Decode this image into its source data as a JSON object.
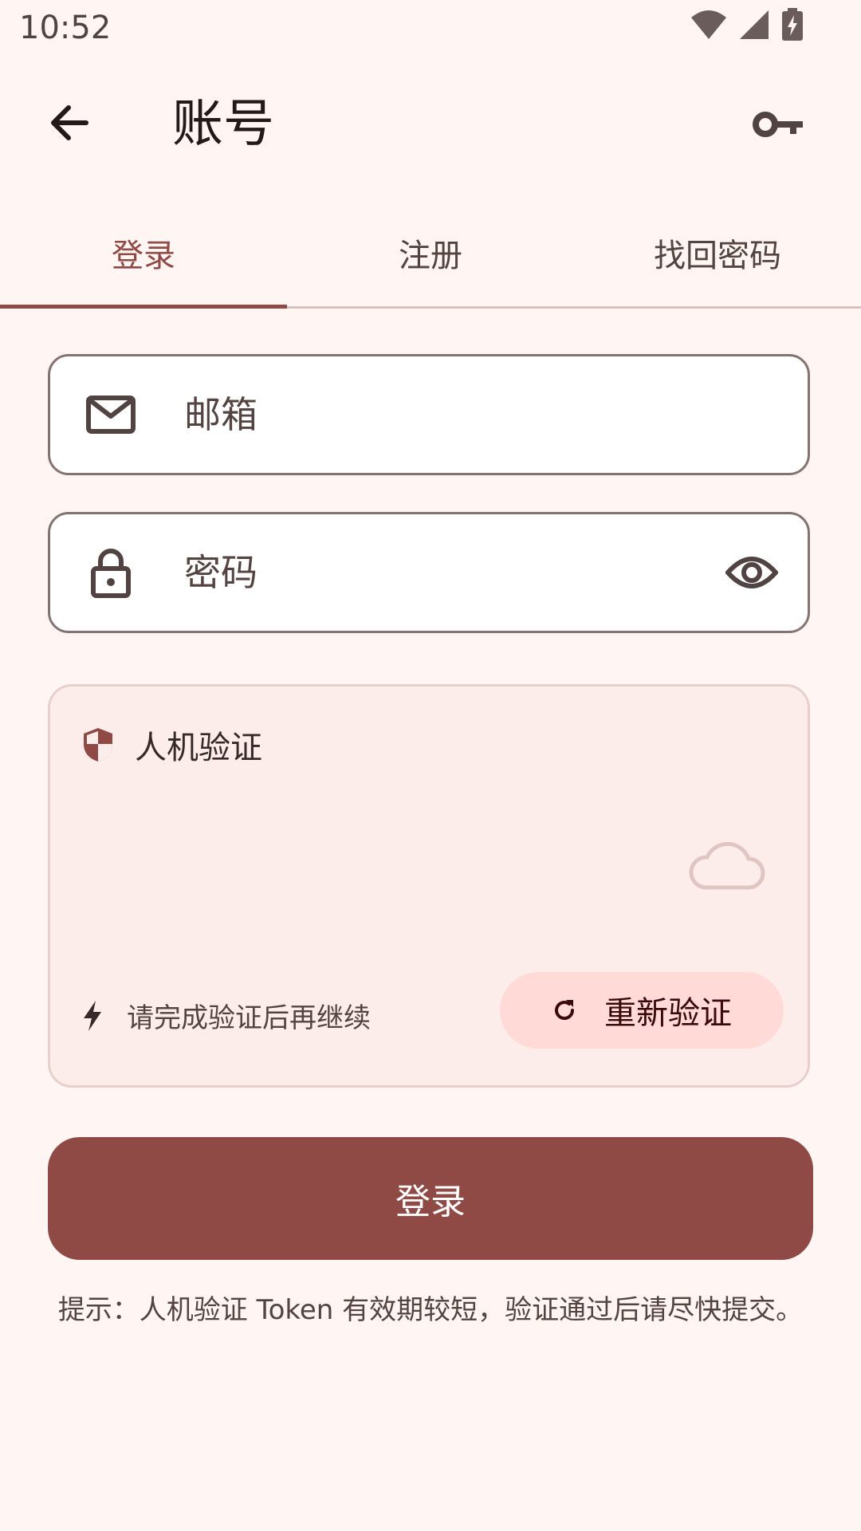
{
  "status_bar": {
    "time": "10:52"
  },
  "app_bar": {
    "title": "账号"
  },
  "tabs": [
    {
      "label": "登录",
      "active": true
    },
    {
      "label": "注册",
      "active": false
    },
    {
      "label": "找回密码",
      "active": false
    }
  ],
  "form": {
    "email_placeholder": "邮箱",
    "password_placeholder": "密码"
  },
  "captcha": {
    "title": "人机验证",
    "hint": "请完成验证后再继续",
    "reverify_label": "重新验证"
  },
  "login_button_label": "登录",
  "tip": "提示：人机验证 Token 有效期较短，验证通过后请尽快提交。",
  "colors": {
    "primary": "#904A45",
    "background": "#FFF5F3",
    "captcha_background": "#FDEDEA",
    "tonal_button": "#FFDAD6"
  },
  "icons": [
    "wifi-icon",
    "signal-icon",
    "battery-charging-icon",
    "back-arrow-icon",
    "key-icon",
    "mail-icon",
    "lock-icon",
    "eye-icon",
    "shield-icon",
    "cloud-icon",
    "bolt-icon",
    "refresh-icon"
  ]
}
